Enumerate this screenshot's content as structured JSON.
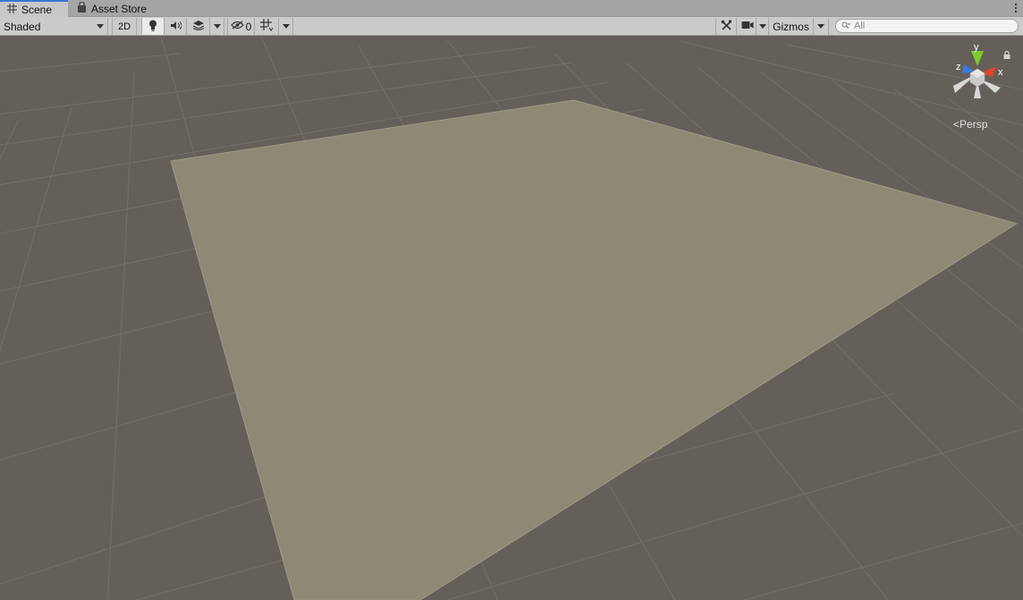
{
  "tabs": [
    {
      "label": "Scene",
      "icon": "grid-icon",
      "active": true
    },
    {
      "label": "Asset Store",
      "icon": "shopping-bag-icon",
      "active": false
    }
  ],
  "toolbar": {
    "draw_mode": "Shaded",
    "toggle_2d": "2D",
    "lighting_icon": "lightbulb-icon",
    "audio_icon": "speaker-icon",
    "effects_icon": "layers-icon",
    "hidden_count": "0",
    "grid_icon": "grid-snap-icon",
    "tools_icon": "tools-icon",
    "camera_icon": "camera-icon",
    "gizmos_label": "Gizmos",
    "search_placeholder": "All"
  },
  "scene": {
    "projection_label": "Persp",
    "axis_labels": {
      "x": "x",
      "y": "y",
      "z": "z"
    },
    "colors": {
      "background": "#646059",
      "grid": "#747069",
      "plane": "#8c8875",
      "axis_x": "#e2422e",
      "axis_y": "#7ccb27",
      "axis_z": "#3a7be0"
    }
  }
}
